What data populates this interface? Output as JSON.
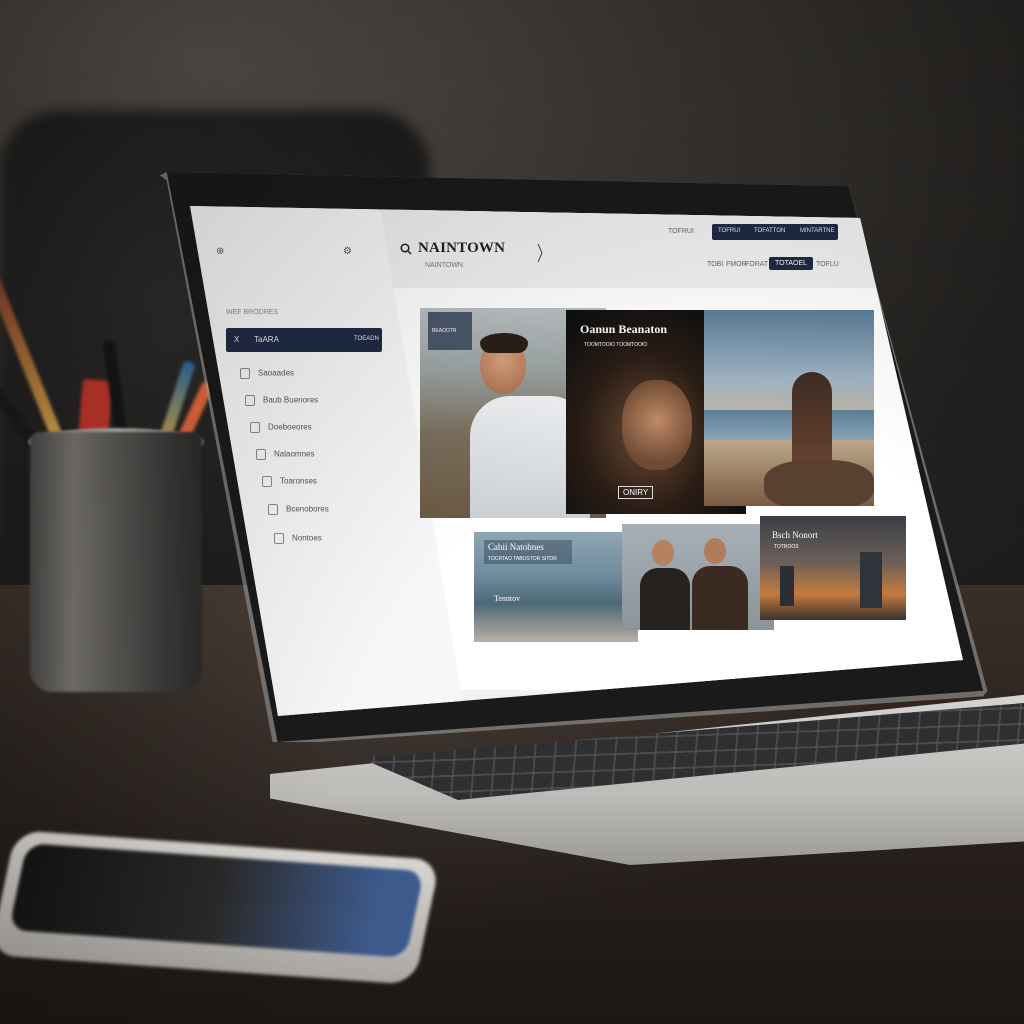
{
  "app": {
    "brand": "NAINTOWN",
    "brand_sub": "NAINTOWN",
    "top_links": [
      "TOFRUI",
      "TOFATTON",
      "MINTARTNE"
    ],
    "top_corner": "TOFRUI",
    "header_nav": [
      "TOBI",
      "FMOR",
      "FORAT",
      "TOTAOEL",
      "TOFLU"
    ]
  },
  "sidebar": {
    "top_left_icon": "⊕",
    "top_right_icon": "⚙",
    "heading": "WEF BRODRES",
    "active_item": {
      "icon": "X",
      "label": "TaARA",
      "badge": "TOEADN"
    },
    "items": [
      {
        "label": "Saoaades"
      },
      {
        "label": "Baub Buenores"
      },
      {
        "label": "Doeboeores"
      },
      {
        "label": "Nalaomnes"
      },
      {
        "label": "Toaronses"
      },
      {
        "label": "Bcenobores"
      },
      {
        "label": "Nontoes"
      }
    ]
  },
  "gallery": {
    "cards": [
      {
        "caption": "",
        "badge": "BEAOOTR"
      },
      {
        "caption": "Oanun Beanaton",
        "sub": "TOOMTOOIO TOOMTOOIO",
        "chip": "ONIRY"
      },
      {
        "caption": ""
      },
      {
        "caption": "Cabii Natobnes",
        "sub": "TOCRTAO TABOSTOR SITOR",
        "chip": "Tenntov"
      },
      {
        "caption": ""
      },
      {
        "caption": "Bsch Nonort",
        "sub": "TOTROOS"
      }
    ]
  },
  "colors": {
    "accent": "#1f2a44",
    "screen_bg": "#f2f2f2",
    "sidebar_bg": "#f7f7f7"
  }
}
